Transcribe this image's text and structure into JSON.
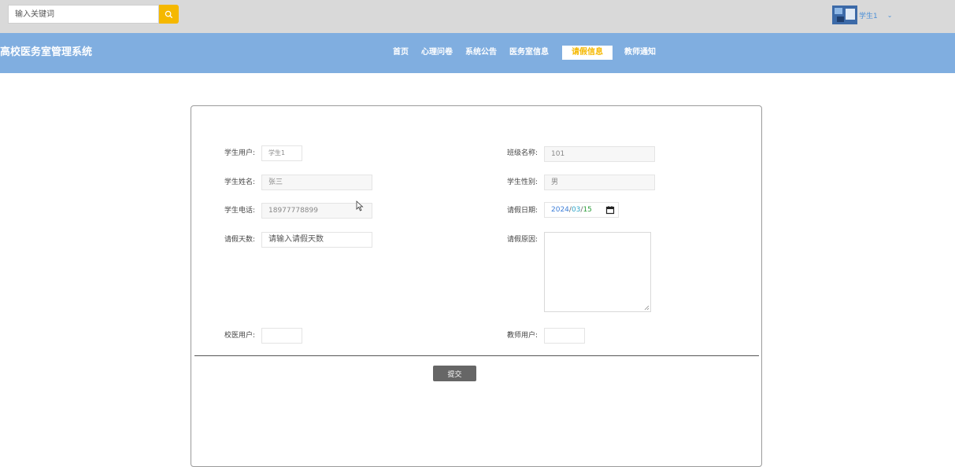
{
  "search": {
    "placeholder": "输入关键词"
  },
  "user": {
    "name": "学生1"
  },
  "header": {
    "title": "高校医务室管理系统"
  },
  "nav": {
    "items": [
      {
        "label": "首页"
      },
      {
        "label": "心理问卷"
      },
      {
        "label": "系统公告"
      },
      {
        "label": "医务室信息"
      },
      {
        "label": "请假信息"
      },
      {
        "label": "教师通知"
      }
    ],
    "active_index": 4
  },
  "form": {
    "student_user_label": "学生用户:",
    "student_user_value": "学生1",
    "class_name_label": "班级名称:",
    "class_name_value": "101",
    "student_name_label": "学生姓名:",
    "student_name_value": "张三",
    "student_gender_label": "学生性别:",
    "student_gender_value": "男",
    "student_phone_label": "学生电话:",
    "student_phone_value": "18977778899",
    "leave_date_label": "请假日期:",
    "leave_date": {
      "year": "2024",
      "month": "03",
      "day": "15"
    },
    "leave_days_label": "请假天数:",
    "leave_days_placeholder": "请输入请假天数",
    "leave_reason_label": "请假原因:",
    "doctor_user_label": "校医用户:",
    "teacher_user_label": "教师用户:",
    "submit_label": "提交"
  },
  "colors": {
    "nav_bg": "#80aee0",
    "accent": "#f5b800",
    "topbar_bg": "#d9d9d9"
  }
}
